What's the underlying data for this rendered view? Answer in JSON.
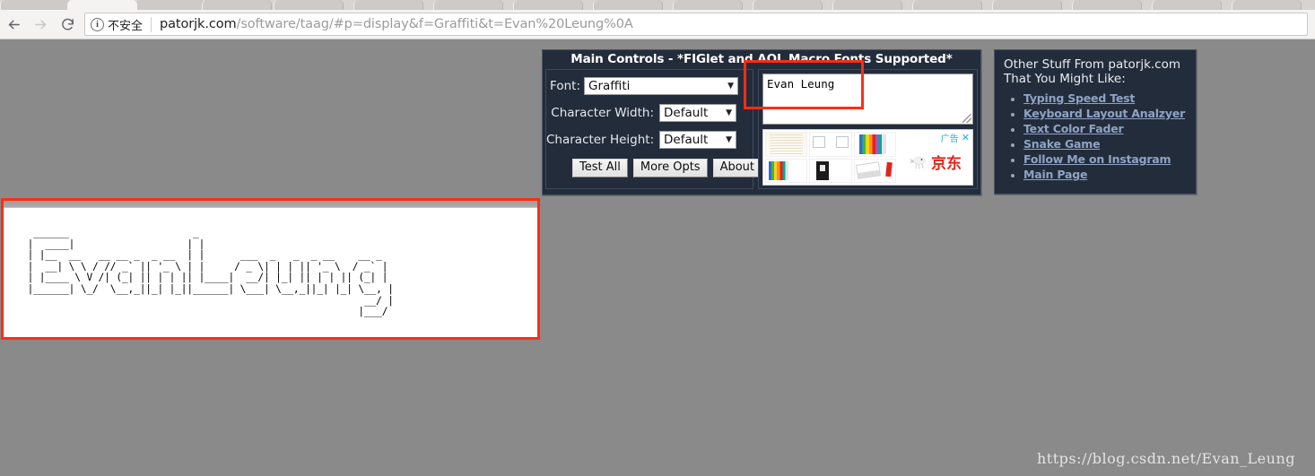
{
  "browser": {
    "back_icon": "back-arrow-icon",
    "forward_icon": "forward-arrow-icon",
    "reload_icon": "reload-icon",
    "security_label": "不安全",
    "url_host": "patorjk.com",
    "url_path": "/software/taag/#p=display&f=Graffiti&t=Evan%20Leung%0A",
    "url_full": "patorjk.com/software/taag/#p=display&f=Graffiti&t=Evan%20Leung%0A",
    "tab_count": 17,
    "active_tab_index": 1
  },
  "main_controls": {
    "title": "Main Controls - *FIGlet and AOL Macro Fonts Supported*",
    "font_label": "Font:",
    "font_value": "Graffiti",
    "char_width_label": "Character Width:",
    "char_width_value": "Default",
    "char_height_label": "Character Height:",
    "char_height_value": "Default",
    "buttons": [
      {
        "name": "test-all-button",
        "label": "Test All"
      },
      {
        "name": "more-opts-button",
        "label": "More Opts"
      },
      {
        "name": "about-button",
        "label": "About"
      }
    ],
    "input_text": "Evan Leung",
    "input_placeholder": ""
  },
  "ad": {
    "flag_label": "广告",
    "close_label": "✕",
    "brand": "京东",
    "thumb_count": 6
  },
  "other_stuff": {
    "title": "Other Stuff From patorjk.com\nThat You Might Like:",
    "links": [
      "Typing Speed Test",
      "Keyboard Layout Analzyer",
      "Text Color Fader",
      "Snake Game",
      "Follow Me on Instagram",
      "Main Page"
    ]
  },
  "output": {
    "ascii_art": "  ______                     _                            \n |  ____|                   | |                           \n | |__  __   __ __ _  _ __  | |      ___  _   _  _ __    __ _ \n |  __| \\ \\ / // _` || '_ \\ | |     / _ \\| | | || '_ \\  / _` |\n | |____ \\ V /| (_| || | | || |____|  __/| |_| || | | || (_| |\n |______| \\_/  \\__,_||_| |_||______| \\___| \\__,_||_| |_| \\__, |\n                                                          __/ |\n                                                         |___/ ",
    "font_name": "Graffiti",
    "rendered_text": "Evan Leung"
  },
  "watermark": "https://blog.csdn.net/Evan_Leung",
  "colors": {
    "page_background": "#8a8a8a",
    "panel_background": "#232c3b",
    "panel_border": "#4a5566",
    "link": "#8fa3c4",
    "annotation_red": "#fe2d14",
    "ad_brand_red": "#e1251b",
    "ad_flag_blue": "#29aae1"
  }
}
